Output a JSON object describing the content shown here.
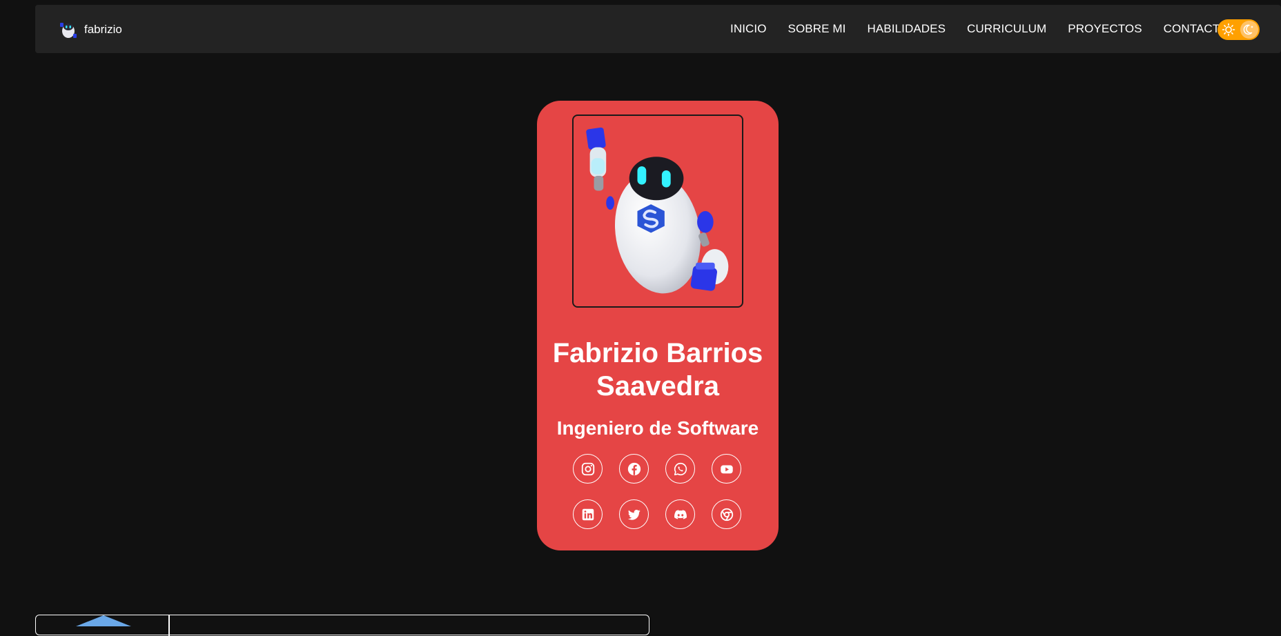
{
  "navbar": {
    "brand": {
      "name": "fabrizio",
      "logo_icon": "robot-logo-icon"
    },
    "links": [
      {
        "label": "INICIO"
      },
      {
        "label": "SOBRE MI"
      },
      {
        "label": "HABILIDADES"
      },
      {
        "label": "CURRICULUM"
      },
      {
        "label": "PROYECTOS"
      },
      {
        "label": "CONTACTO"
      }
    ],
    "theme_toggle": {
      "icons": [
        "sun-icon",
        "moon-icon"
      ],
      "color": "#ffa000"
    }
  },
  "profile": {
    "name": "Fabrizio Barrios Saavedra",
    "role": "Ingeniero de Software",
    "card_color": "#e54545",
    "avatar_icon": "robot-avatar",
    "socials_row1": [
      "instagram-icon",
      "facebook-icon",
      "whatsapp-icon",
      "youtube-icon"
    ],
    "socials_row2": [
      "linkedin-icon",
      "twitter-icon",
      "discord-icon",
      "chrome-icon"
    ]
  },
  "colors": {
    "background": "#111111",
    "navbar": "#232323",
    "accent": "#e54545",
    "toggle": "#ffa000"
  }
}
